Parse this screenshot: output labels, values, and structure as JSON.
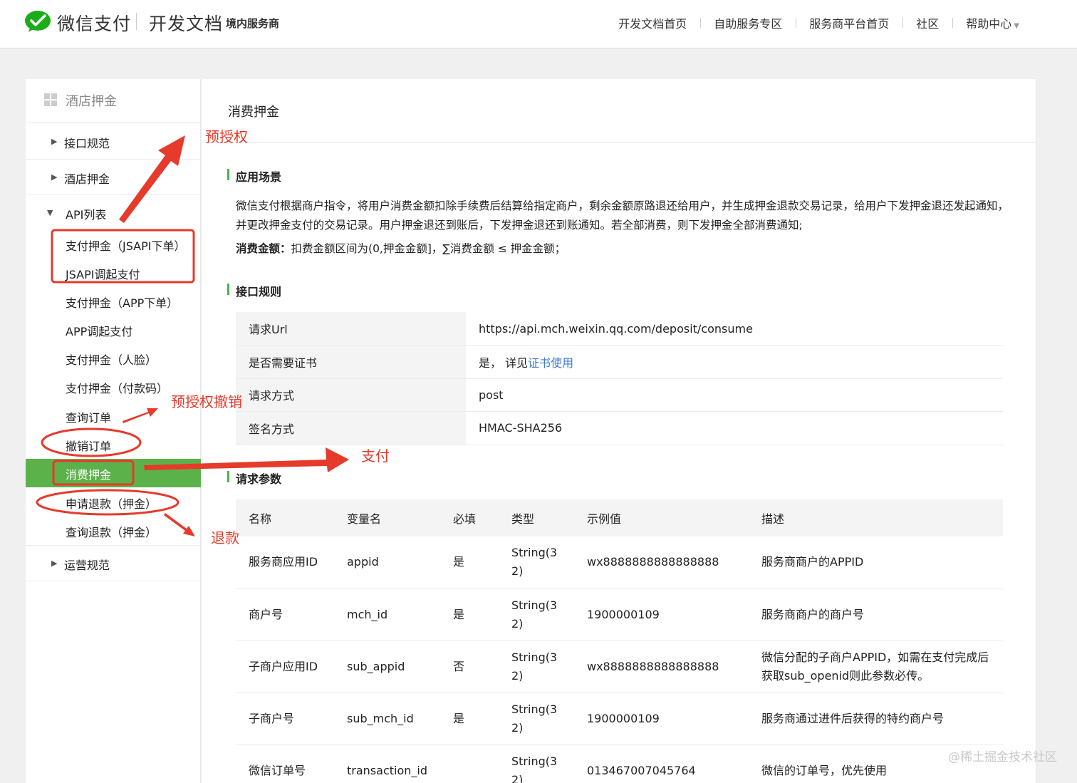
{
  "header": {
    "brand": "微信支付",
    "doc_title": "开发文档",
    "doc_subtitle": "境内服务商",
    "nav": [
      "开发文档首页",
      "自助服务专区",
      "服务商平台首页",
      "社区",
      "帮助中心"
    ]
  },
  "sidebar": {
    "title": "酒店押金",
    "groups": [
      "接口规范",
      "酒店押金",
      "API列表",
      "运营规范"
    ],
    "api_items": [
      "支付押金（JSAPI下单）",
      "JSAPI调起支付",
      "支付押金（APP下单）",
      "APP调起支付",
      "支付押金（人脸）",
      "支付押金（付款码）",
      "查询订单",
      "撤销订单",
      "消费押金",
      "申请退款（押金）",
      "查询退款（押金）"
    ],
    "active_item": "消费押金"
  },
  "main": {
    "title": "消费押金",
    "scene_heading": "应用场景",
    "scene_text": "微信支付根据商户指令，将用户消费金额扣除手续费后结算给指定商户，剩余金额原路退还给用户，并生成押金退款交易记录，给用户下发押金退还发起通知，并更改押金支付的交易记录。用户押金退还到账后，下发押金退还到账通知。若全部消费，则下发押金全部消费通知;",
    "amount_label": "消费金额：",
    "amount_text": "扣费金额区间为(0,押金金额]，∑消费金额 ≤  押金金额；",
    "rules_heading": "接口规则",
    "rules": [
      {
        "key": "请求Url",
        "value": "https://api.mch.weixin.qq.com/deposit/consume"
      },
      {
        "key": "是否需要证书",
        "value": "是， 详见",
        "link": "证书使用"
      },
      {
        "key": "请求方式",
        "value": "post"
      },
      {
        "key": "签名方式",
        "value": "HMAC-SHA256"
      }
    ],
    "params_heading": "请求参数",
    "params_headers": [
      "名称",
      "变量名",
      "必填",
      "类型",
      "示例值",
      "描述"
    ],
    "params_rows": [
      [
        "服务商应用ID",
        "appid",
        "是",
        "String(32)",
        "wx8888888888888888",
        "服务商商户的APPID"
      ],
      [
        "商户号",
        "mch_id",
        "是",
        "String(32)",
        "1900000109",
        "服务商商户的商户号"
      ],
      [
        "子商户应用ID",
        "sub_appid",
        "否",
        "String(32)",
        "wx8888888888888888",
        "微信分配的子商户APPID，如需在支付完成后获取sub_openid则此参数必传。"
      ],
      [
        "子商户号",
        "sub_mch_id",
        "是",
        "String(32)",
        "1900000109",
        "服务商通过进件后获得的特约商户号"
      ],
      [
        "微信订单号",
        "transaction_id",
        "",
        "String(32)",
        "013467007045764",
        "微信的订单号，优先使用"
      ]
    ]
  },
  "annotations": {
    "preauth": "预授权",
    "preauth_cancel": "预授权撤销",
    "pay": "支付",
    "refund": "退款",
    "color": "#e63a2b"
  },
  "watermark": "@稀土掘金技术社区",
  "colors": {
    "accent_green": "#5bb24a",
    "link_blue": "#3a7bd5",
    "page_bg": "#f0f0f0"
  }
}
